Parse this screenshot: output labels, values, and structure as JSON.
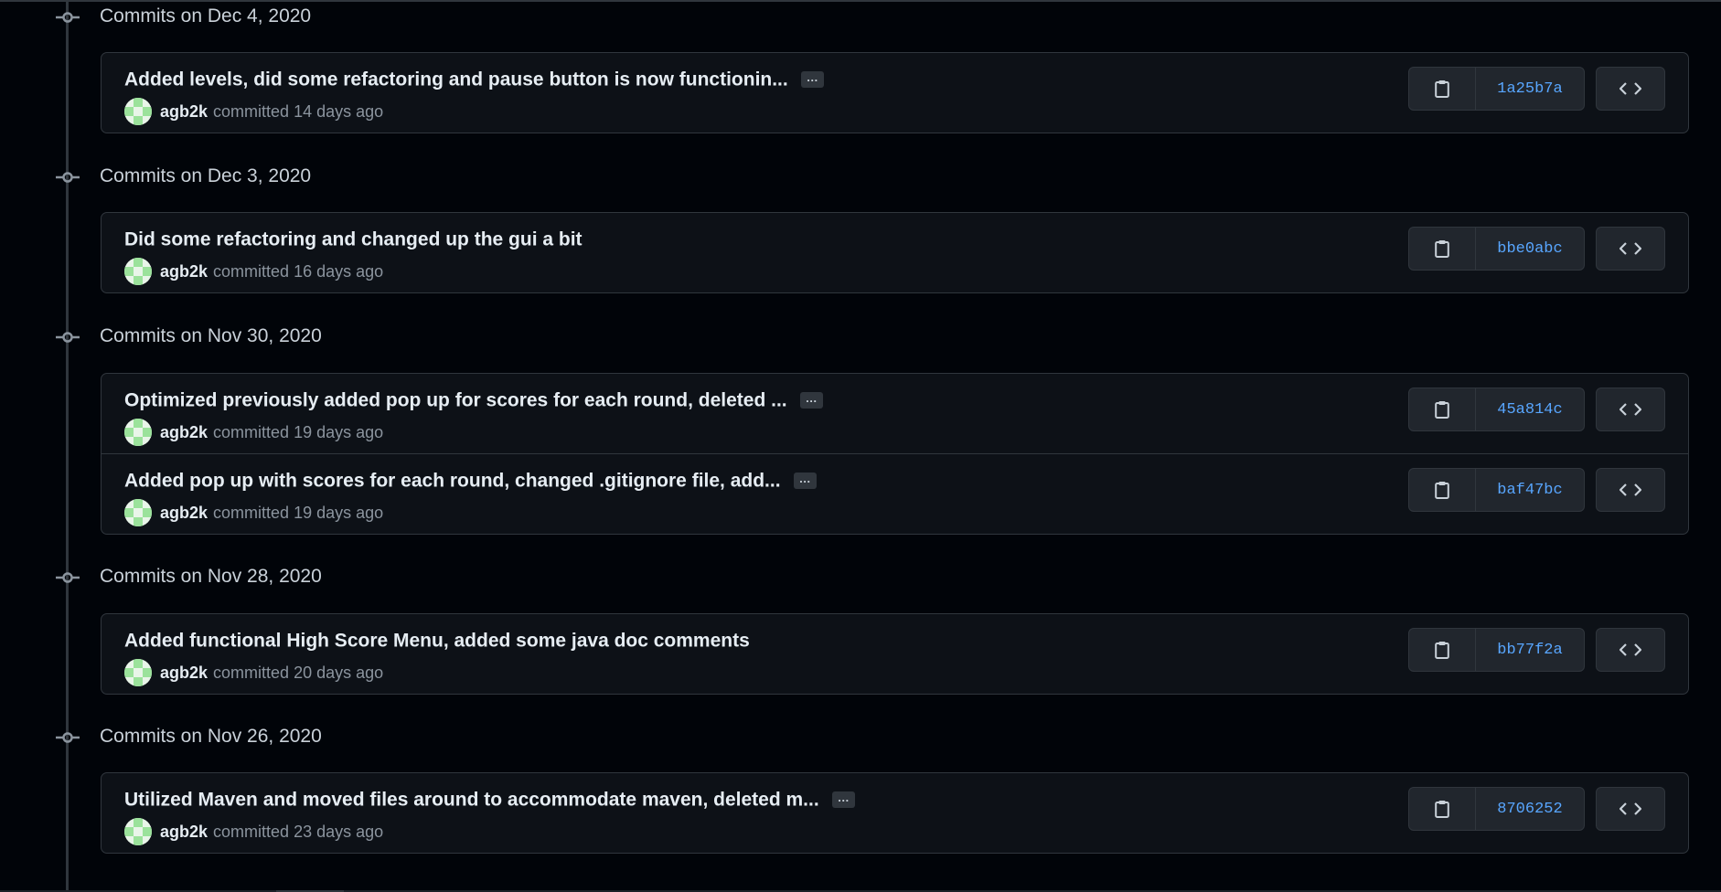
{
  "groups": [
    {
      "title": "Commits on Dec 4, 2020",
      "commits": [
        {
          "message": "Added levels, did some refactoring and pause button is now functionin...",
          "ellipsis": "…",
          "author": "agb2k",
          "action": "committed",
          "time": "14 days ago",
          "sha": "1a25b7a"
        }
      ]
    },
    {
      "title": "Commits on Dec 3, 2020",
      "commits": [
        {
          "message": "Did some refactoring and changed up the gui a bit",
          "ellipsis": "",
          "author": "agb2k",
          "action": "committed",
          "time": "16 days ago",
          "sha": "bbe0abc"
        }
      ]
    },
    {
      "title": "Commits on Nov 30, 2020",
      "commits": [
        {
          "message": "Optimized previously added pop up for scores for each round, deleted ...",
          "ellipsis": "…",
          "author": "agb2k",
          "action": "committed",
          "time": "19 days ago",
          "sha": "45a814c"
        },
        {
          "message": "Added pop up with scores for each round, changed .gitignore file, add...",
          "ellipsis": "…",
          "author": "agb2k",
          "action": "committed",
          "time": "19 days ago",
          "sha": "baf47bc"
        }
      ]
    },
    {
      "title": "Commits on Nov 28, 2020",
      "commits": [
        {
          "message": "Added functional High Score Menu, added some java doc comments",
          "ellipsis": "",
          "author": "agb2k",
          "action": "committed",
          "time": "20 days ago",
          "sha": "bb77f2a"
        }
      ]
    },
    {
      "title": "Commits on Nov 26, 2020",
      "commits": [
        {
          "message": "Utilized Maven and moved files around to accommodate maven, deleted m...",
          "ellipsis": "…",
          "author": "agb2k",
          "action": "committed",
          "time": "23 days ago",
          "sha": "8706252"
        }
      ]
    }
  ],
  "icons": {
    "timeline_node": "git-commit-icon",
    "copy": "clipboard-icon",
    "browse": "code-icon"
  },
  "colors": {
    "background": "#010409",
    "card": "#0d1117",
    "border": "#30363d",
    "sha_link": "#58a6ff",
    "avatar_green": "#9be29b"
  }
}
